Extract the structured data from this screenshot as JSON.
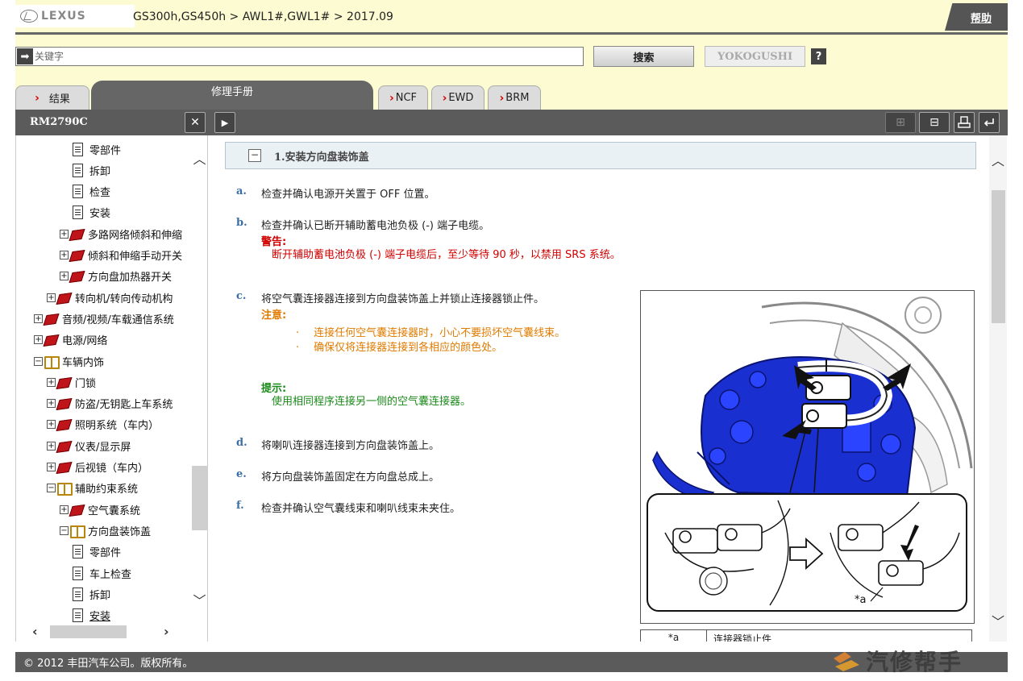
{
  "header": {
    "brand": "LEXUS",
    "breadcrumb": "GS300h,GS450h > AWL1#,GWL1# > 2017.09",
    "help_label": "帮助"
  },
  "search": {
    "placeholder": "关键字",
    "search_label": "搜索",
    "yokogushi_label": "YOKOGUSHI",
    "help_q": "?"
  },
  "tabs": {
    "results": "结果",
    "manual": "修理手册",
    "ncf": "NCF",
    "ewd": "EWD",
    "brm": "BRM"
  },
  "toolbar": {
    "doc_code": "RM2790C",
    "close": "✕",
    "play": "▶",
    "expand": "⊞",
    "collapse": "⊟"
  },
  "tree": {
    "items": [
      {
        "label": "零部件",
        "icon": "doc-icon"
      },
      {
        "label": "拆卸",
        "icon": "doc-icon"
      },
      {
        "label": "检查",
        "icon": "doc-icon"
      },
      {
        "label": "安装",
        "icon": "doc-icon"
      },
      {
        "label": "多路网络倾斜和伸缩",
        "icon": "book-icon",
        "toggle": "+"
      },
      {
        "label": "倾斜和伸缩手动开关",
        "icon": "book-icon",
        "toggle": "+"
      },
      {
        "label": "方向盘加热器开关",
        "icon": "book-icon",
        "toggle": "+"
      },
      {
        "label": "转向机/转向传动机构",
        "icon": "book-icon",
        "toggle": "+"
      },
      {
        "label": "音频/视频/车载通信系统",
        "icon": "book-icon",
        "toggle": "+"
      },
      {
        "label": "电源/网络",
        "icon": "book-icon",
        "toggle": "+"
      },
      {
        "label": "车辆内饰",
        "icon": "open-book-icon",
        "toggle": "−"
      },
      {
        "label": "门锁",
        "icon": "book-icon",
        "toggle": "+"
      },
      {
        "label": "防盗/无钥匙上车系统",
        "icon": "book-icon",
        "toggle": "+"
      },
      {
        "label": "照明系统（车内）",
        "icon": "book-icon",
        "toggle": "+"
      },
      {
        "label": "仪表/显示屏",
        "icon": "book-icon",
        "toggle": "+"
      },
      {
        "label": "后视镜（车内）",
        "icon": "book-icon",
        "toggle": "+"
      },
      {
        "label": "辅助约束系统",
        "icon": "open-book-icon",
        "toggle": "−"
      },
      {
        "label": "空气囊系统",
        "icon": "book-icon",
        "toggle": "+"
      },
      {
        "label": "方向盘装饰盖",
        "icon": "open-book-icon",
        "toggle": "−"
      },
      {
        "label": "零部件",
        "icon": "doc-icon"
      },
      {
        "label": "车上检查",
        "icon": "doc-icon"
      },
      {
        "label": "拆卸",
        "icon": "doc-icon"
      },
      {
        "label": "安装",
        "icon": "doc-icon"
      }
    ]
  },
  "content": {
    "section_toggle": "−",
    "section_title": "1.安装方向盘装饰盖",
    "steps": {
      "a": {
        "label": "a.",
        "text": "检查并确认电源开关置于 OFF 位置。"
      },
      "b": {
        "label": "b.",
        "text": "检查并确认已断开辅助蓄电池负极 (-) 端子电缆。"
      },
      "c": {
        "label": "c.",
        "text": "将空气囊连接器连接到方向盘装饰盖上并锁止连接器锁止件。"
      },
      "d": {
        "label": "d.",
        "text": "将喇叭连接器连接到方向盘装饰盖上。"
      },
      "e": {
        "label": "e.",
        "text": "将方向盘装饰盖固定在方向盘总成上。"
      },
      "f": {
        "label": "f.",
        "text": "检查并确认空气囊线束和喇叭线束未夹住。"
      }
    },
    "warning": {
      "title": "警告:",
      "text": "断开辅助蓄电池负极 (-) 端子电缆后，至少等待 90 秒，以禁用 SRS 系统。"
    },
    "notice": {
      "title": "注意:",
      "bullet": "·",
      "lines": [
        "连接任何空气囊连接器时，小心不要损坏空气囊线束。",
        "确保仅将连接器连接到各相应的颜色处。"
      ]
    },
    "hint": {
      "title": "提示:",
      "text": "使用相同程序连接另一侧的空气囊连接器。"
    },
    "figure": {
      "callout": "*a"
    },
    "legend": {
      "key": "*a",
      "value": "连接器锁止件"
    }
  },
  "footer": {
    "copyright": "© 2012 丰田汽车公司。版权所有。"
  },
  "watermark": {
    "text": "汽修帮手"
  },
  "colors": {
    "header_bg": "#fdfbd2",
    "toolbar_bg": "#5b5b5b",
    "warning": "#d10000",
    "notice": "#e07b00",
    "hint": "#1a8a1a",
    "step_label": "#3a6ea5",
    "figure_blue": "#1a2fd0"
  }
}
